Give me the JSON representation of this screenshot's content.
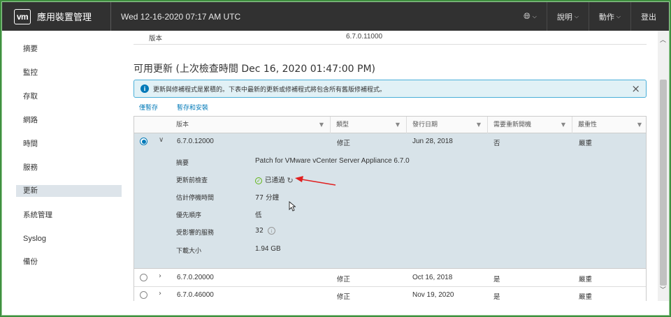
{
  "header": {
    "logo_text": "vm",
    "app_title": "應用裝置管理",
    "datetime": "Wed 12-16-2020 07:17 AM UTC",
    "language_icon": "globe-icon",
    "help_label": "說明",
    "actions_label": "動作",
    "logout_label": "登出"
  },
  "sidebar": {
    "items": [
      {
        "label": "摘要"
      },
      {
        "label": "監控"
      },
      {
        "label": "存取"
      },
      {
        "label": "網路"
      },
      {
        "label": "時間"
      },
      {
        "label": "服務"
      },
      {
        "label": "更新"
      },
      {
        "label": "系統管理"
      },
      {
        "label": "Syslog"
      },
      {
        "label": "備份"
      }
    ],
    "active_index": 6
  },
  "main": {
    "version_label": "版本",
    "version_value": "6.7.0.11000",
    "section_title": "可用更新 (上次檢查時間 Dec 16, 2020 01:47:00 PM)",
    "alert_text": "更新與修補程式是累積的。下表中最新的更新或修補程式將包含所有舊版修補程式。",
    "alert_close": "×",
    "stage_only": "僅暫存",
    "stage_install": "暫存和安裝"
  },
  "table": {
    "columns": [
      "版本",
      "類型",
      "發行日期",
      "需要重新開機",
      "嚴重性"
    ],
    "rows": [
      {
        "version": "6.7.0.12000",
        "type": "修正",
        "release_date": "Jun 28, 2018",
        "reboot": "否",
        "severity": "嚴重",
        "selected": true,
        "expanded": true
      },
      {
        "version": "6.7.0.20000",
        "type": "修正",
        "release_date": "Oct 16, 2018",
        "reboot": "是",
        "severity": "嚴重",
        "selected": false,
        "expanded": false
      },
      {
        "version": "6.7.0.46000",
        "type": "修正",
        "release_date": "Nov 19, 2020",
        "reboot": "是",
        "severity": "嚴重",
        "selected": false,
        "expanded": false
      }
    ],
    "details": {
      "summary_label": "摘要",
      "summary_value": "Patch for VMware vCenter Server Appliance 6.7.0",
      "precheck_label": "更新前檢查",
      "precheck_value": "已通過",
      "downtime_label": "估計停機時間",
      "downtime_value": "77 分鐘",
      "priority_label": "優先順序",
      "priority_value": "低",
      "services_label": "受影響的服務",
      "services_value": "32",
      "download_label": "下載大小",
      "download_value": "1.94 GB"
    }
  },
  "colors": {
    "header_bg": "#313131",
    "accent": "#0079b8",
    "selected_row": "#d8e3e9",
    "alert_bg": "#e1f1f6",
    "success": "#60b515",
    "annotation_arrow": "#e02020"
  }
}
